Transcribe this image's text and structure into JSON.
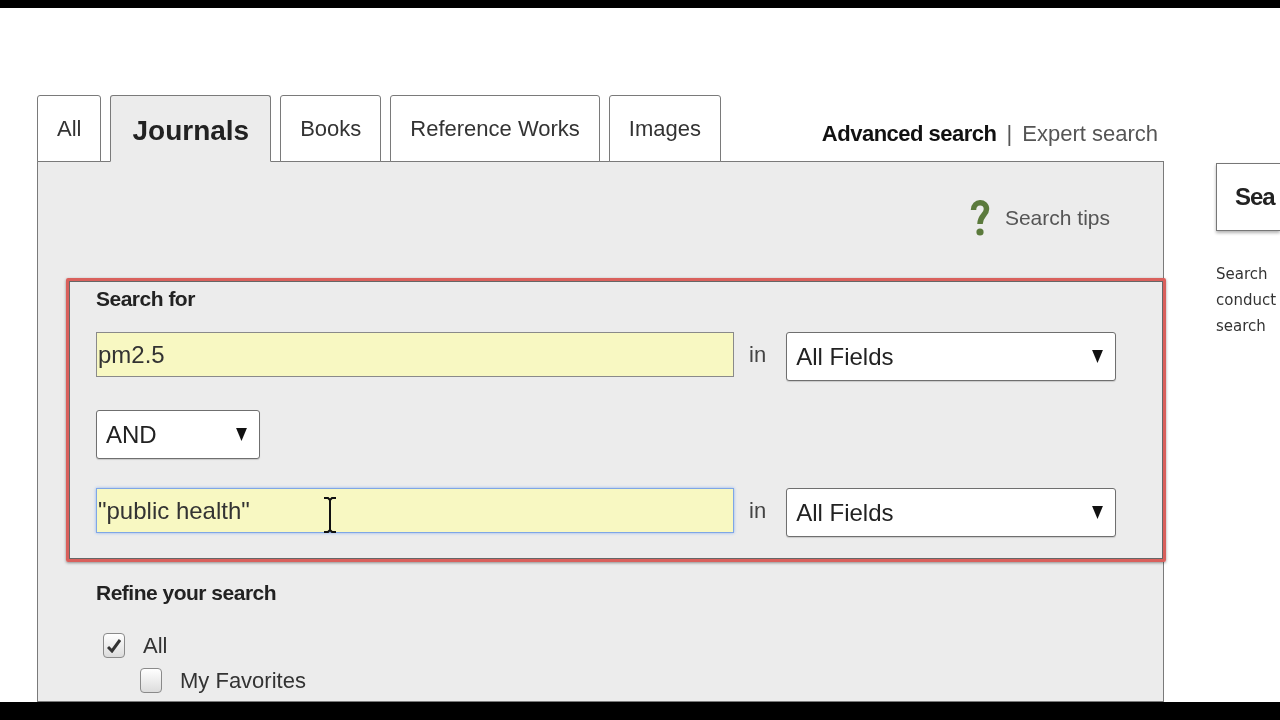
{
  "tabs": [
    {
      "label": "All",
      "selected": false
    },
    {
      "label": "Journals",
      "selected": true
    },
    {
      "label": "Books",
      "selected": false
    },
    {
      "label": "Reference Works",
      "selected": false
    },
    {
      "label": "Images",
      "selected": false
    }
  ],
  "search_modes": [
    {
      "label": "Advanced search",
      "selected": true
    },
    {
      "label": "Expert search",
      "selected": false
    }
  ],
  "mode_separator": "|",
  "search_tips": {
    "label": "Search tips"
  },
  "search_for": {
    "title": "Search for",
    "highlighted": true,
    "rows": [
      {
        "kind": "term",
        "value": "pm2.5",
        "focused": false,
        "in_label": "in",
        "field": "All Fields"
      },
      {
        "kind": "operator",
        "value": "AND"
      },
      {
        "kind": "term",
        "value": "\"public health\"",
        "focused": true,
        "in_label": "in",
        "field": "All Fields"
      }
    ]
  },
  "refine": {
    "title": "Refine your search",
    "options": [
      {
        "label": "All",
        "checked": true,
        "children": [
          {
            "label": "My Favorites",
            "checked": false
          }
        ]
      }
    ]
  },
  "side_panel": {
    "button": "Sea",
    "description_lines": [
      "Search",
      "conduct",
      "search"
    ]
  }
}
